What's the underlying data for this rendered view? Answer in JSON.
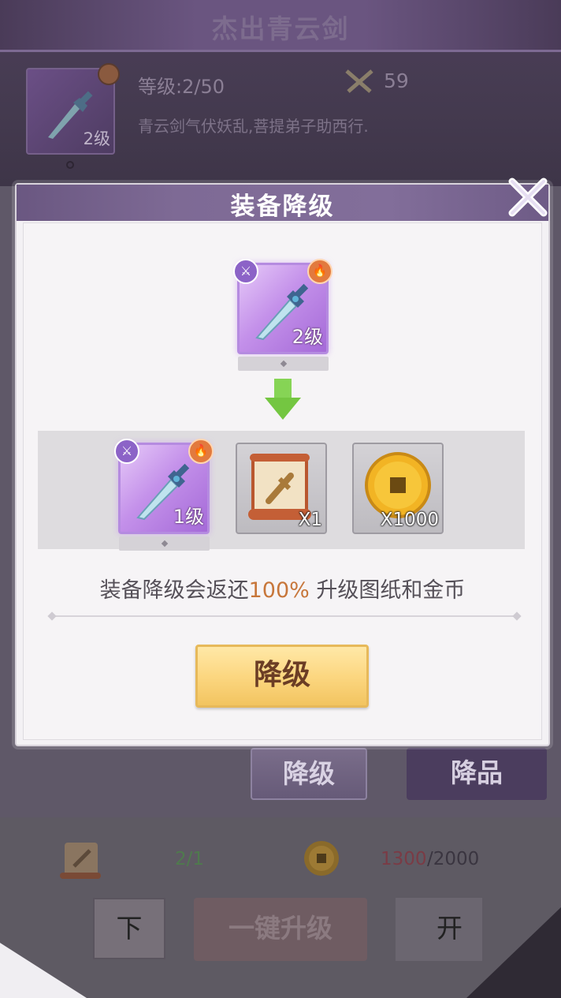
{
  "background": {
    "equipment_title": "杰出青云剑",
    "item_level_badge": "2级",
    "level_text": "等级:2/50",
    "power_value": "59",
    "description": "青云剑气伏妖乱,菩提弟子助西行.",
    "tab_downgrade": "降级",
    "tab_degrade_quality": "降品",
    "scroll_count": "2/1",
    "coin_have": "1300",
    "coin_need": "/2000",
    "btn_down": "下",
    "btn_one_click_upgrade": "一键升级",
    "btn_right_partial": "开"
  },
  "modal": {
    "title": "装备降级",
    "current_item_level": "2级",
    "result_item_level": "1级",
    "scroll_qty": "X1",
    "coin_qty": "X1000",
    "info_prefix": "装备降级会返还",
    "info_percent": "100%",
    "info_suffix": " 升级图纸和金币",
    "confirm_label": "降级"
  },
  "colors": {
    "accent_purple": "#7e6a95",
    "button_gold": "#fcd781",
    "percent_orange": "#c7763a",
    "arrow_green": "#7fd04a"
  }
}
